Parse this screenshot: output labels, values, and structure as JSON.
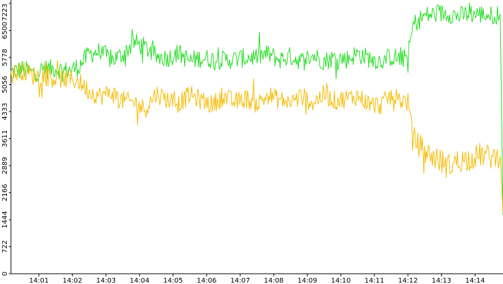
{
  "chart_data": {
    "type": "line",
    "title": "",
    "xlabel": "",
    "ylabel": "",
    "ylim": [
      0,
      7223
    ],
    "y_ticks": [
      0,
      722,
      1444,
      2166,
      2889,
      3611,
      4333,
      5056,
      5778,
      6500,
      7223
    ],
    "x_range": [
      "14:00:10",
      "14:14:50"
    ],
    "x_ticks": [
      {
        "t": "14:01:00",
        "label": "14:01"
      },
      {
        "t": "14:02:00",
        "label": "14:02"
      },
      {
        "t": "14:03:00",
        "label": "14:03"
      },
      {
        "t": "14:04:00",
        "label": "14:04"
      },
      {
        "t": "14:05:00",
        "label": "14:05"
      },
      {
        "t": "14:06:00",
        "label": "14:06"
      },
      {
        "t": "14:07:00",
        "label": "14:07"
      },
      {
        "t": "14:08:00",
        "label": "14:08"
      },
      {
        "t": "14:09:00",
        "label": "14:09"
      },
      {
        "t": "14:10:00",
        "label": "14:10"
      },
      {
        "t": "14:11:00",
        "label": "14:11"
      },
      {
        "t": "14:12:00",
        "label": "14:12"
      },
      {
        "t": "14:13:00",
        "label": "14:13"
      },
      {
        "t": "14:14:00",
        "label": "14:14"
      }
    ],
    "grid": false,
    "legend": "none",
    "series": [
      {
        "color": "#22dd22",
        "points": [
          [
            "14:00:10",
            5390
          ],
          [
            "14:00:30",
            5460
          ],
          [
            "14:00:50",
            5360
          ],
          [
            "14:01:10",
            5470
          ],
          [
            "14:01:30",
            5480
          ],
          [
            "14:01:50",
            5420
          ],
          [
            "14:02:10",
            5520
          ],
          [
            "14:02:30",
            5880
          ],
          [
            "14:02:50",
            5940
          ],
          [
            "14:03:10",
            5710
          ],
          [
            "14:03:30",
            5860
          ],
          [
            "14:03:50",
            6180
          ],
          [
            "14:04:10",
            6050
          ],
          [
            "14:04:30",
            5800
          ],
          [
            "14:04:50",
            5770
          ],
          [
            "14:05:10",
            5900
          ],
          [
            "14:05:30",
            5680
          ],
          [
            "14:05:50",
            5770
          ],
          [
            "14:06:10",
            5730
          ],
          [
            "14:06:30",
            5710
          ],
          [
            "14:06:50",
            5730
          ],
          [
            "14:07:10",
            5770
          ],
          [
            "14:07:30",
            5800
          ],
          [
            "14:07:50",
            5870
          ],
          [
            "14:08:10",
            5720
          ],
          [
            "14:08:30",
            5810
          ],
          [
            "14:08:50",
            5680
          ],
          [
            "14:09:10",
            5830
          ],
          [
            "14:09:30",
            5690
          ],
          [
            "14:09:50",
            5770
          ],
          [
            "14:10:10",
            5730
          ],
          [
            "14:10:30",
            5880
          ],
          [
            "14:10:50",
            5760
          ],
          [
            "14:11:10",
            5680
          ],
          [
            "14:11:30",
            5800
          ],
          [
            "14:11:50",
            5730
          ],
          [
            "14:12:00",
            5840
          ],
          [
            "14:12:10",
            6670
          ],
          [
            "14:12:30",
            6890
          ],
          [
            "14:12:50",
            6940
          ],
          [
            "14:13:10",
            6970
          ],
          [
            "14:13:30",
            6880
          ],
          [
            "14:13:50",
            6950
          ],
          [
            "14:14:10",
            6930
          ],
          [
            "14:14:30",
            6900
          ],
          [
            "14:14:45",
            6930
          ],
          [
            "14:14:50",
            1570
          ]
        ]
      },
      {
        "color": "#f5bb00",
        "points": [
          [
            "14:00:10",
            5310
          ],
          [
            "14:00:30",
            5440
          ],
          [
            "14:00:50",
            5300
          ],
          [
            "14:01:10",
            5270
          ],
          [
            "14:01:30",
            5220
          ],
          [
            "14:01:50",
            5200
          ],
          [
            "14:02:10",
            5160
          ],
          [
            "14:02:30",
            4870
          ],
          [
            "14:02:50",
            4750
          ],
          [
            "14:03:10",
            4840
          ],
          [
            "14:03:30",
            4630
          ],
          [
            "14:03:50",
            4580
          ],
          [
            "14:04:10",
            4400
          ],
          [
            "14:04:30",
            4820
          ],
          [
            "14:04:50",
            4660
          ],
          [
            "14:05:10",
            4550
          ],
          [
            "14:05:30",
            4780
          ],
          [
            "14:05:50",
            4640
          ],
          [
            "14:06:10",
            4520
          ],
          [
            "14:06:30",
            4740
          ],
          [
            "14:06:50",
            4580
          ],
          [
            "14:07:10",
            4690
          ],
          [
            "14:07:30",
            4530
          ],
          [
            "14:07:50",
            4770
          ],
          [
            "14:08:10",
            4650
          ],
          [
            "14:08:30",
            4590
          ],
          [
            "14:08:50",
            4740
          ],
          [
            "14:09:10",
            4570
          ],
          [
            "14:09:30",
            4790
          ],
          [
            "14:09:50",
            4620
          ],
          [
            "14:10:10",
            4680
          ],
          [
            "14:10:30",
            4750
          ],
          [
            "14:10:50",
            4550
          ],
          [
            "14:11:10",
            4490
          ],
          [
            "14:11:30",
            4760
          ],
          [
            "14:11:50",
            4630
          ],
          [
            "14:12:00",
            4590
          ],
          [
            "14:12:10",
            3620
          ],
          [
            "14:12:30",
            3260
          ],
          [
            "14:12:50",
            3090
          ],
          [
            "14:13:10",
            2870
          ],
          [
            "14:13:30",
            3010
          ],
          [
            "14:13:50",
            3080
          ],
          [
            "14:14:10",
            3180
          ],
          [
            "14:14:30",
            3110
          ],
          [
            "14:14:45",
            3150
          ],
          [
            "14:14:50",
            1650
          ]
        ]
      }
    ]
  }
}
